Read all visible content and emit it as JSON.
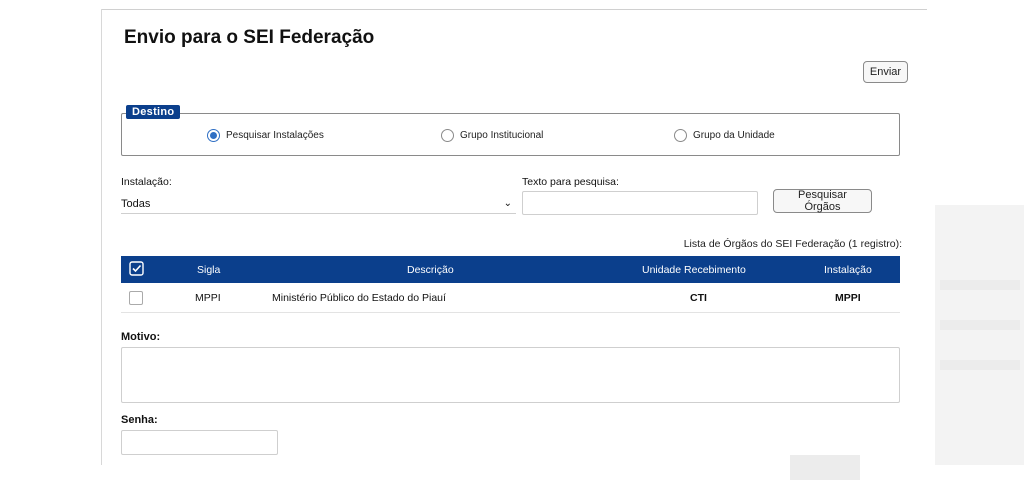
{
  "title": "Envio para o SEI Federação",
  "send_button": "Enviar",
  "destino": {
    "legend": "Destino",
    "options": [
      "Pesquisar Instalações",
      "Grupo Institucional",
      "Grupo da Unidade"
    ],
    "selected": "Pesquisar Instalações"
  },
  "instalacao": {
    "label": "Instalação:",
    "value": "Todas"
  },
  "pesquisa": {
    "label": "Texto para pesquisa:",
    "value": "",
    "button": "Pesquisar Órgãos"
  },
  "table": {
    "caption": "Lista de Órgãos do SEI Federação (1 registro):",
    "headers": [
      "Sigla",
      "Descrição",
      "Unidade Recebimento",
      "Instalação"
    ],
    "rows": [
      [
        "MPPI",
        "Ministério Público do Estado do Piauí",
        "CTI",
        "MPPI"
      ]
    ]
  },
  "motivo": {
    "label": "Motivo:",
    "value": ""
  },
  "senha": {
    "label": "Senha:",
    "value": ""
  },
  "colors": {
    "primary": "#0b3f8c",
    "radio_selected": "#2f6fc4"
  }
}
